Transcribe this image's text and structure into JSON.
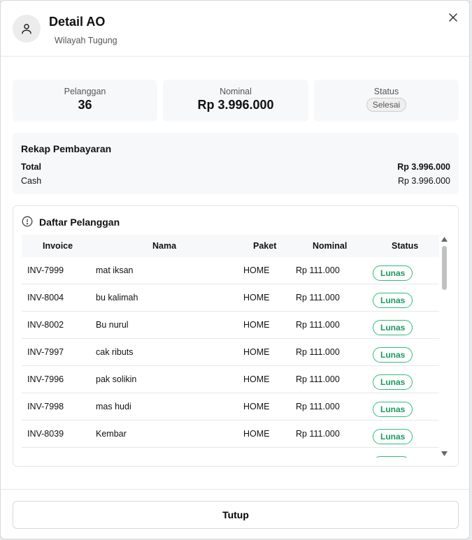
{
  "header": {
    "title": "Detail AO",
    "subtitle": "Wilayah Tugung",
    "avatar_icon": "user-icon",
    "close_icon": "close-icon"
  },
  "stats": {
    "pelanggan": {
      "label": "Pelanggan",
      "value": "36"
    },
    "nominal": {
      "label": "Nominal",
      "value": "Rp 3.996.000"
    },
    "status": {
      "label": "Status",
      "value": "Selesai"
    }
  },
  "rekap": {
    "title": "Rekap Pembayaran",
    "total_label": "Total",
    "total_value": "Rp 3.996.000",
    "cash_label": "Cash",
    "cash_value": "Rp 3.996.000"
  },
  "daftar": {
    "title": "Daftar Pelanggan",
    "icon": "info-icon",
    "columns": {
      "invoice": "Invoice",
      "nama": "Nama",
      "paket": "Paket",
      "nominal": "Nominal",
      "status": "Status"
    },
    "rows": [
      {
        "invoice": "INV-7999",
        "nama": "mat iksan",
        "paket": "HOME",
        "nominal": "Rp 111.000",
        "status": "Lunas"
      },
      {
        "invoice": "INV-8004",
        "nama": "bu kalimah",
        "paket": "HOME",
        "nominal": "Rp 111.000",
        "status": "Lunas"
      },
      {
        "invoice": "INV-8002",
        "nama": "Bu nurul",
        "paket": "HOME",
        "nominal": "Rp 111.000",
        "status": "Lunas"
      },
      {
        "invoice": "INV-7997",
        "nama": "cak ributs",
        "paket": "HOME",
        "nominal": "Rp 111.000",
        "status": "Lunas"
      },
      {
        "invoice": "INV-7996",
        "nama": "pak solikin",
        "paket": "HOME",
        "nominal": "Rp 111.000",
        "status": "Lunas"
      },
      {
        "invoice": "INV-7998",
        "nama": "mas hudi",
        "paket": "HOME",
        "nominal": "Rp 111.000",
        "status": "Lunas"
      },
      {
        "invoice": "INV-8039",
        "nama": "Kembar",
        "paket": "HOME",
        "nominal": "Rp 111.000",
        "status": "Lunas"
      },
      {
        "invoice": "",
        "nama": "",
        "paket": "",
        "nominal": "",
        "status": ""
      }
    ]
  },
  "footer": {
    "close_button": "Tutup"
  },
  "colors": {
    "accent_green": "#2ebd7a",
    "muted_bg": "#f7f8fa"
  }
}
